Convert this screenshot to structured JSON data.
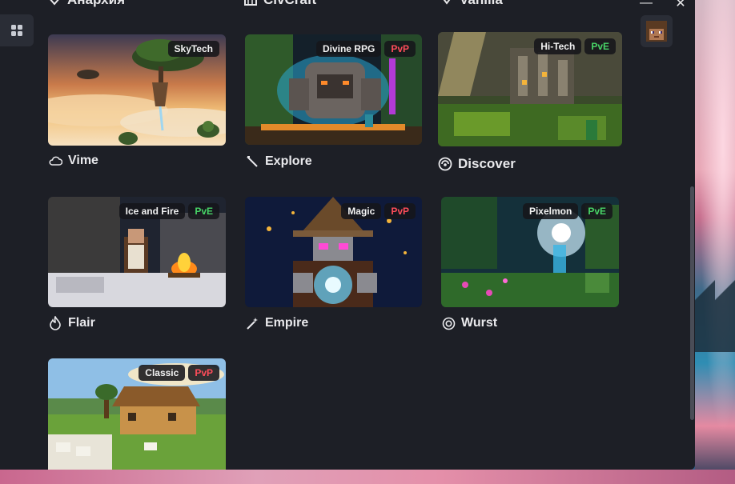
{
  "header": {
    "items": [
      {
        "label": "Анархия",
        "icon": "skull-icon"
      },
      {
        "label": "CivCraft",
        "icon": "building-icon"
      },
      {
        "label": "Vanilla",
        "icon": "cube-icon"
      }
    ],
    "minimize_label": "—",
    "close_label": "✕"
  },
  "servers": [
    {
      "name": "Vime",
      "icon": "cloud-icon",
      "tags": [
        {
          "label": "SkyTech",
          "kind": "neutral"
        }
      ]
    },
    {
      "name": "Explore",
      "icon": "pickaxe-icon",
      "tags": [
        {
          "label": "Divine RPG",
          "kind": "neutral"
        },
        {
          "label": "PvP",
          "kind": "pvp"
        }
      ]
    },
    {
      "name": "Discover",
      "icon": "globe-icon",
      "tags": [
        {
          "label": "Hi-Tech",
          "kind": "neutral"
        },
        {
          "label": "PvE",
          "kind": "pve"
        }
      ]
    },
    {
      "name": "Flair",
      "icon": "flame-icon",
      "tags": [
        {
          "label": "Ice and Fire",
          "kind": "neutral"
        },
        {
          "label": "PvE",
          "kind": "pve"
        }
      ]
    },
    {
      "name": "Empire",
      "icon": "magic-wand-icon",
      "tags": [
        {
          "label": "Magic",
          "kind": "neutral"
        },
        {
          "label": "PvP",
          "kind": "pvp"
        }
      ]
    },
    {
      "name": "Wurst",
      "icon": "target-icon",
      "tags": [
        {
          "label": "Pixelmon",
          "kind": "neutral"
        },
        {
          "label": "PvE",
          "kind": "pve"
        }
      ]
    },
    {
      "name": "",
      "icon": "",
      "tags": [
        {
          "label": "Classic",
          "kind": "neutral"
        },
        {
          "label": "PvP",
          "kind": "pvp"
        }
      ]
    }
  ],
  "colors": {
    "window_bg": "#1d1f26",
    "pvp": "#ff4d5a",
    "pve": "#48d467"
  }
}
